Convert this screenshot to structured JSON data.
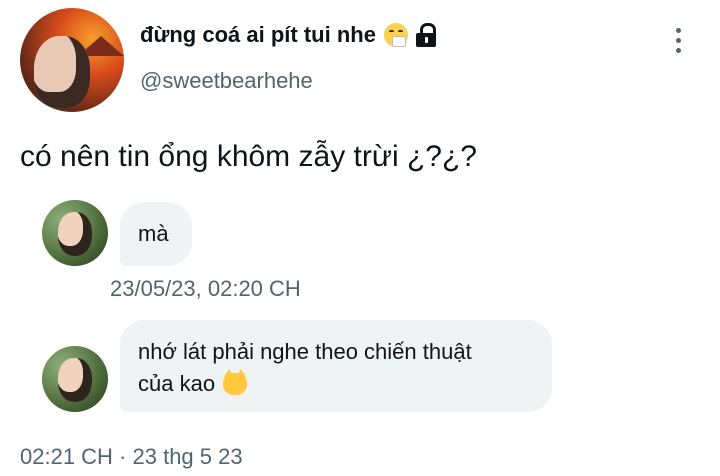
{
  "author": {
    "display_name": "đừng coá ai pít tui nhe",
    "handle": "@sweetbearhehe",
    "name_emoji": "sneezing-face-icon",
    "protected_icon": "lock-icon"
  },
  "tweet": {
    "text": "có nên tin ổng khôm zẫy trừi ¿?¿?",
    "meta": "02:21 CH · 23 thg 5 23"
  },
  "messages": [
    {
      "text": "mà",
      "timestamp": "23/05/23, 02:20 CH"
    },
    {
      "line1": "nhớ lát phải nghe theo chiến thuật",
      "line2": "của kao",
      "emoji": "pouting-cat-icon"
    }
  ],
  "colors": {
    "text": "#0f1419",
    "secondary": "#536471",
    "bubble": "#eff3f4"
  }
}
